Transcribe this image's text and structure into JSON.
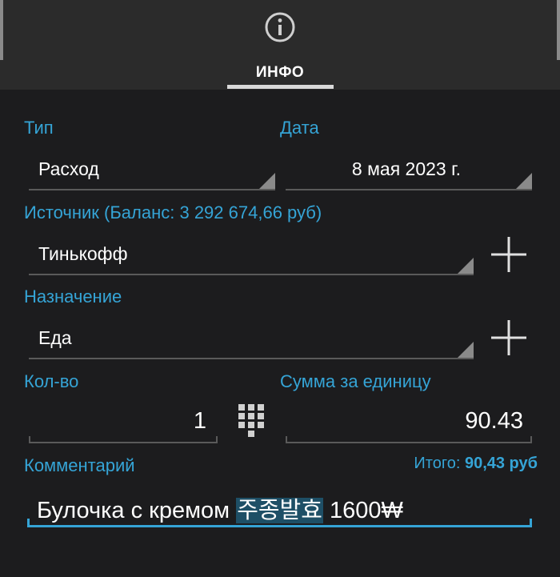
{
  "tabs": [
    {
      "label": "ИНФО",
      "icon": "info-icon",
      "active": true
    }
  ],
  "form": {
    "type": {
      "label": "Тип",
      "value": "Расход"
    },
    "date": {
      "label": "Дата",
      "value": "8 мая 2023 г."
    },
    "source": {
      "label": "Источник (Баланс: 3 292 674,66 руб)",
      "value": "Тинькофф"
    },
    "destination": {
      "label": "Назначение",
      "value": "Еда"
    },
    "quantity": {
      "label": "Кол-во",
      "value": "1"
    },
    "unit_price": {
      "label": "Сумма за единицу",
      "value": "90.43"
    },
    "comment": {
      "label": "Комментарий",
      "text_before": "Булочка с кремом ",
      "text_selected": "주종발효",
      "text_after": " 1600₩"
    },
    "total": {
      "label": "Итого:",
      "value": "90,43 руб"
    }
  },
  "colors": {
    "accent": "#35a4d6",
    "background": "#1c1c1e",
    "topbar": "#2b2b2b",
    "selection": "#1e4f66"
  }
}
